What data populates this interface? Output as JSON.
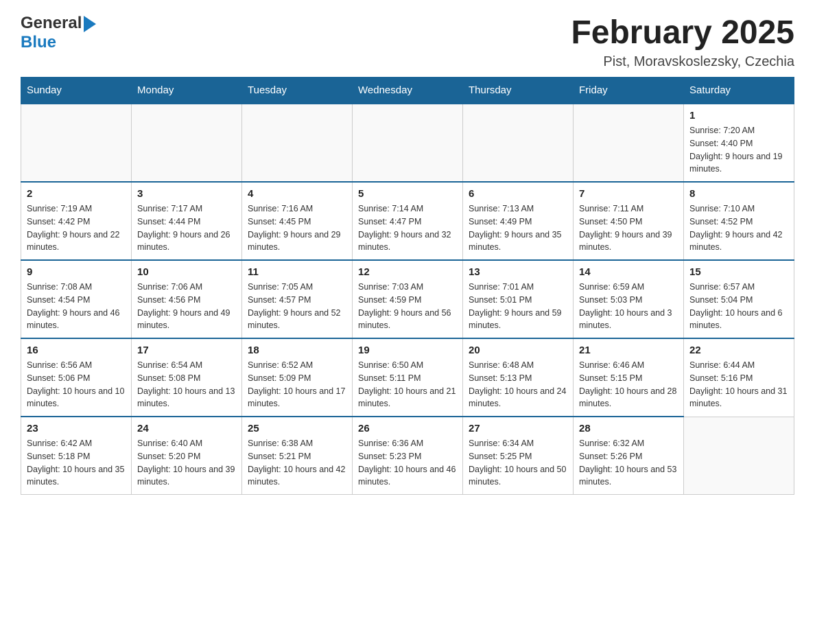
{
  "header": {
    "logo_general": "General",
    "logo_blue": "Blue",
    "month_title": "February 2025",
    "location": "Pist, Moravskoslezsky, Czechia"
  },
  "days_of_week": [
    "Sunday",
    "Monday",
    "Tuesday",
    "Wednesday",
    "Thursday",
    "Friday",
    "Saturday"
  ],
  "weeks": [
    [
      {
        "day": "",
        "info": ""
      },
      {
        "day": "",
        "info": ""
      },
      {
        "day": "",
        "info": ""
      },
      {
        "day": "",
        "info": ""
      },
      {
        "day": "",
        "info": ""
      },
      {
        "day": "",
        "info": ""
      },
      {
        "day": "1",
        "info": "Sunrise: 7:20 AM\nSunset: 4:40 PM\nDaylight: 9 hours and 19 minutes."
      }
    ],
    [
      {
        "day": "2",
        "info": "Sunrise: 7:19 AM\nSunset: 4:42 PM\nDaylight: 9 hours and 22 minutes."
      },
      {
        "day": "3",
        "info": "Sunrise: 7:17 AM\nSunset: 4:44 PM\nDaylight: 9 hours and 26 minutes."
      },
      {
        "day": "4",
        "info": "Sunrise: 7:16 AM\nSunset: 4:45 PM\nDaylight: 9 hours and 29 minutes."
      },
      {
        "day": "5",
        "info": "Sunrise: 7:14 AM\nSunset: 4:47 PM\nDaylight: 9 hours and 32 minutes."
      },
      {
        "day": "6",
        "info": "Sunrise: 7:13 AM\nSunset: 4:49 PM\nDaylight: 9 hours and 35 minutes."
      },
      {
        "day": "7",
        "info": "Sunrise: 7:11 AM\nSunset: 4:50 PM\nDaylight: 9 hours and 39 minutes."
      },
      {
        "day": "8",
        "info": "Sunrise: 7:10 AM\nSunset: 4:52 PM\nDaylight: 9 hours and 42 minutes."
      }
    ],
    [
      {
        "day": "9",
        "info": "Sunrise: 7:08 AM\nSunset: 4:54 PM\nDaylight: 9 hours and 46 minutes."
      },
      {
        "day": "10",
        "info": "Sunrise: 7:06 AM\nSunset: 4:56 PM\nDaylight: 9 hours and 49 minutes."
      },
      {
        "day": "11",
        "info": "Sunrise: 7:05 AM\nSunset: 4:57 PM\nDaylight: 9 hours and 52 minutes."
      },
      {
        "day": "12",
        "info": "Sunrise: 7:03 AM\nSunset: 4:59 PM\nDaylight: 9 hours and 56 minutes."
      },
      {
        "day": "13",
        "info": "Sunrise: 7:01 AM\nSunset: 5:01 PM\nDaylight: 9 hours and 59 minutes."
      },
      {
        "day": "14",
        "info": "Sunrise: 6:59 AM\nSunset: 5:03 PM\nDaylight: 10 hours and 3 minutes."
      },
      {
        "day": "15",
        "info": "Sunrise: 6:57 AM\nSunset: 5:04 PM\nDaylight: 10 hours and 6 minutes."
      }
    ],
    [
      {
        "day": "16",
        "info": "Sunrise: 6:56 AM\nSunset: 5:06 PM\nDaylight: 10 hours and 10 minutes."
      },
      {
        "day": "17",
        "info": "Sunrise: 6:54 AM\nSunset: 5:08 PM\nDaylight: 10 hours and 13 minutes."
      },
      {
        "day": "18",
        "info": "Sunrise: 6:52 AM\nSunset: 5:09 PM\nDaylight: 10 hours and 17 minutes."
      },
      {
        "day": "19",
        "info": "Sunrise: 6:50 AM\nSunset: 5:11 PM\nDaylight: 10 hours and 21 minutes."
      },
      {
        "day": "20",
        "info": "Sunrise: 6:48 AM\nSunset: 5:13 PM\nDaylight: 10 hours and 24 minutes."
      },
      {
        "day": "21",
        "info": "Sunrise: 6:46 AM\nSunset: 5:15 PM\nDaylight: 10 hours and 28 minutes."
      },
      {
        "day": "22",
        "info": "Sunrise: 6:44 AM\nSunset: 5:16 PM\nDaylight: 10 hours and 31 minutes."
      }
    ],
    [
      {
        "day": "23",
        "info": "Sunrise: 6:42 AM\nSunset: 5:18 PM\nDaylight: 10 hours and 35 minutes."
      },
      {
        "day": "24",
        "info": "Sunrise: 6:40 AM\nSunset: 5:20 PM\nDaylight: 10 hours and 39 minutes."
      },
      {
        "day": "25",
        "info": "Sunrise: 6:38 AM\nSunset: 5:21 PM\nDaylight: 10 hours and 42 minutes."
      },
      {
        "day": "26",
        "info": "Sunrise: 6:36 AM\nSunset: 5:23 PM\nDaylight: 10 hours and 46 minutes."
      },
      {
        "day": "27",
        "info": "Sunrise: 6:34 AM\nSunset: 5:25 PM\nDaylight: 10 hours and 50 minutes."
      },
      {
        "day": "28",
        "info": "Sunrise: 6:32 AM\nSunset: 5:26 PM\nDaylight: 10 hours and 53 minutes."
      },
      {
        "day": "",
        "info": ""
      }
    ]
  ]
}
